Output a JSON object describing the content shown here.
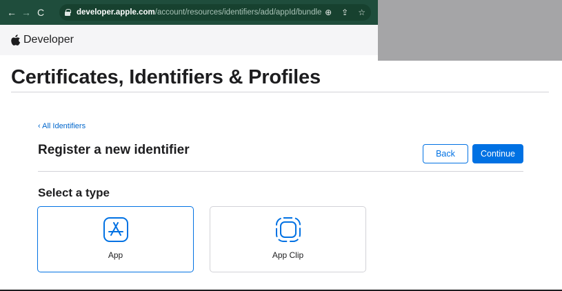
{
  "browser": {
    "back_icon": "←",
    "forward_icon": "→",
    "reload_icon": "C",
    "url_domain": "developer.apple.com",
    "url_path": "/account/resources/identifiers/add/appId/bundle",
    "zoom_icon": "⊕",
    "share_icon": "⇪",
    "star_icon": "☆"
  },
  "header": {
    "brand": "Developer"
  },
  "page": {
    "title": "Certificates, Identifiers & Profiles",
    "breadcrumb": "‹ All Identifiers",
    "section_title": "Register a new identifier",
    "back_label": "Back",
    "continue_label": "Continue",
    "type_title": "Select a type",
    "types": [
      {
        "label": "App",
        "icon": "app-store-icon",
        "selected": true
      },
      {
        "label": "App Clip",
        "icon": "app-clip-icon",
        "selected": false
      }
    ]
  },
  "colors": {
    "accent": "#0071e3",
    "link": "#0066cc",
    "chrome_bg": "#1f4d3c"
  }
}
